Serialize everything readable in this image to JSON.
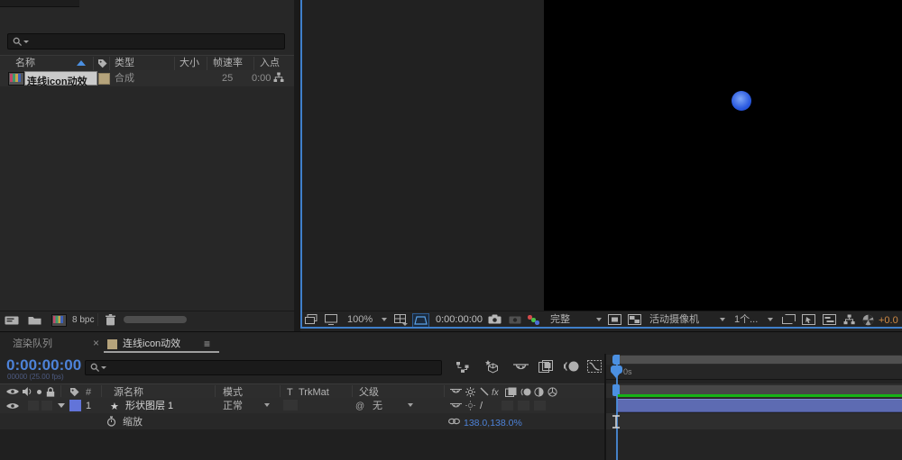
{
  "colors": {
    "accent_border": "#3f7fca",
    "playhead_blue": "#4b90e2",
    "timecode_blue": "#4d82d8",
    "label_tan": "#b5a37b",
    "layer_label_blue": "#6274d9",
    "layer_bar": "#5d6bb2",
    "render_green": "#16b216",
    "exposure_orange": "#cf8a45",
    "comp_circle_blue": "#2a5ae0"
  },
  "project": {
    "columns": {
      "name": "名称",
      "type": "类型",
      "size": "大小",
      "frame_rate": "帧速率",
      "in_point": "入点"
    },
    "item": {
      "name": "连线icon动效",
      "type": "合成",
      "frame_rate": "25",
      "in_point": "0:00"
    },
    "footer": {
      "bpc": "8 bpc"
    }
  },
  "viewer": {
    "toolbar": {
      "zoom": "100%",
      "timecode": "0:00:00:00",
      "resolution": "完整",
      "camera": "活动摄像机",
      "views": "1个...",
      "exposure": "+0.0"
    }
  },
  "timeline": {
    "tabs": {
      "render_queue": "渲染队列",
      "comp": "连线icon动效"
    },
    "timecode": "0:00:00:00",
    "frames_info": "00000 (25.00 fps)",
    "columns": {
      "source_name": "源名称",
      "mode": "模式",
      "t": "T",
      "trkmat": "TrkMat",
      "parent": "父级"
    },
    "layer": {
      "index": "1",
      "name": "形状图层 1",
      "mode": "正常",
      "parent": "无"
    },
    "property": {
      "name": "缩放",
      "value": "138.0,138.0%"
    },
    "ruler": {
      "zero": "0s"
    }
  },
  "glyphs": {
    "close": "×",
    "menu": "≡",
    "pickwhip": "@",
    "star": "★",
    "quality": "/",
    "fx": "fx",
    "hash": "#"
  }
}
